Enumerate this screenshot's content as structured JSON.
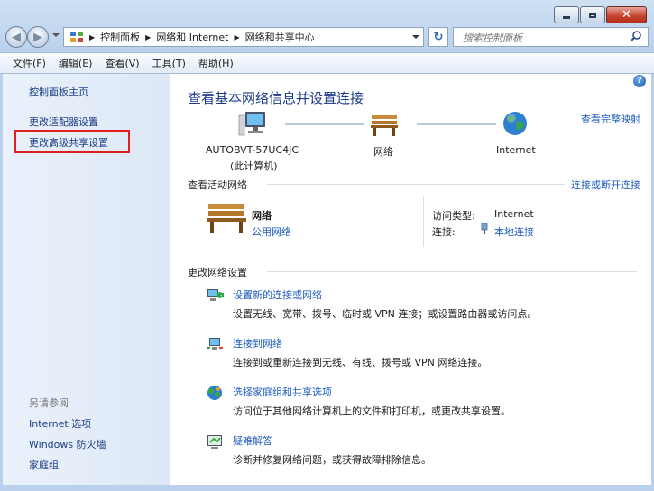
{
  "address": {
    "segments": [
      "控制面板",
      "网络和 Internet",
      "网络和共享中心"
    ]
  },
  "search": {
    "placeholder": "搜索控制面板"
  },
  "menu": [
    "文件(F)",
    "编辑(E)",
    "查看(V)",
    "工具(T)",
    "帮助(H)"
  ],
  "sidebar": {
    "home": "控制面板主页",
    "adapter": "更改适配器设置",
    "advanced": "更改高级共享设置",
    "see_also": "另请参阅",
    "links": [
      "Internet 选项",
      "Windows 防火墙",
      "家庭组"
    ]
  },
  "main": {
    "title": "查看基本网络信息并设置连接",
    "full_map": "查看完整映射",
    "map": {
      "computer_name": "AUTOBVT-57UC4JC",
      "computer_sub": "(此计算机)",
      "network": "网络",
      "internet": "Internet"
    },
    "active_header": "查看活动网络",
    "connect_disconnect": "连接或断开连接",
    "active": {
      "name": "网络",
      "type": "公用网络",
      "access_label": "访问类型:",
      "access_value": "Internet",
      "conn_label": "连接:",
      "conn_value": "本地连接"
    },
    "change_header": "更改网络设置",
    "tasks": [
      {
        "title": "设置新的连接或网络",
        "desc": "设置无线、宽带、拨号、临时或 VPN 连接；或设置路由器或访问点。"
      },
      {
        "title": "连接到网络",
        "desc": "连接到或重新连接到无线、有线、拨号或 VPN 网络连接。"
      },
      {
        "title": "选择家庭组和共享选项",
        "desc": "访问位于其他网络计算机上的文件和打印机，或更改共享设置。"
      },
      {
        "title": "疑难解答",
        "desc": "诊断并修复网络问题，或获得故障排除信息。"
      }
    ]
  },
  "colors": {
    "link": "#1e5cbe",
    "highlight": "#e02020",
    "title": "#1e3b8a"
  }
}
